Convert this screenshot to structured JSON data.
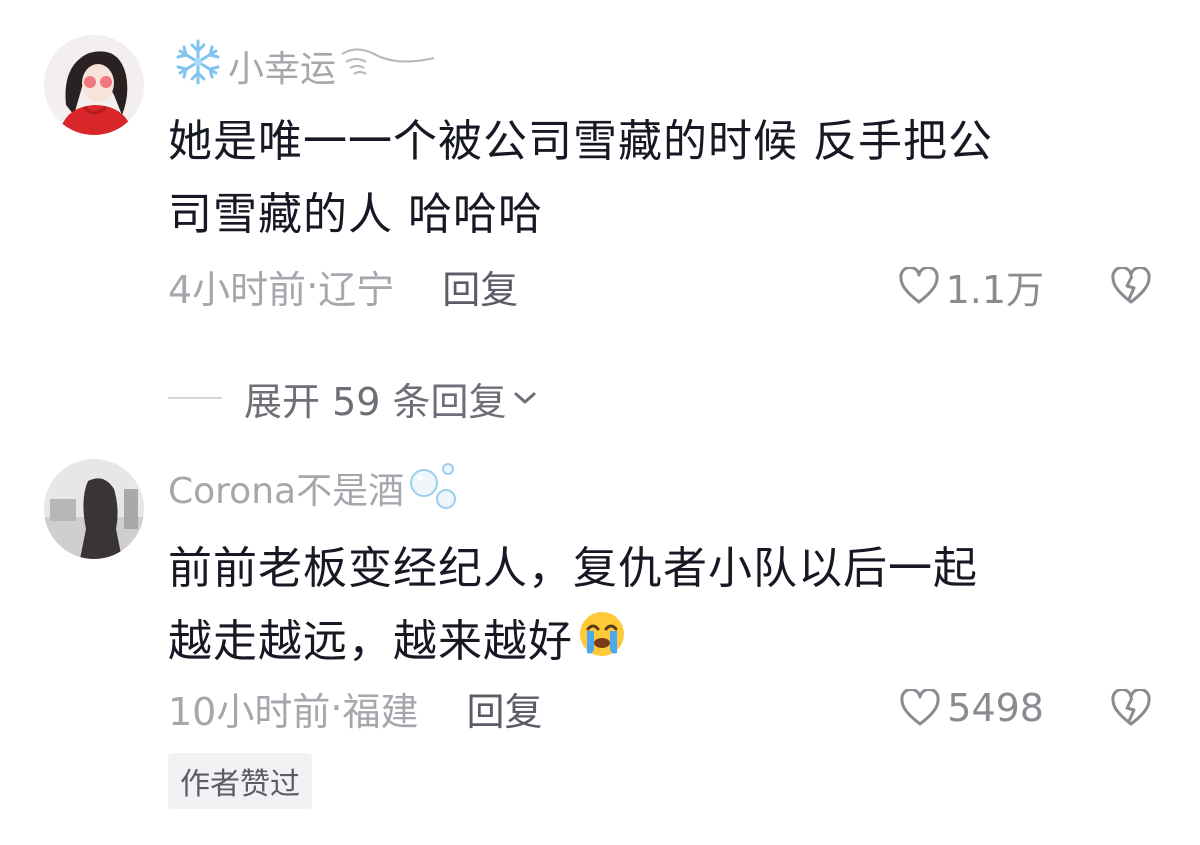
{
  "comments": [
    {
      "username": "小幸运",
      "content_lines": [
        "她是唯一一个被公司雪藏的时候 反手把公",
        "司雪藏的人 哈哈哈"
      ],
      "time": "4小时前",
      "location": "辽宁",
      "reply_label": "回复",
      "likes": "1.1万",
      "name_decorations": [
        "snowflake-icon",
        "wind-swirl-icon"
      ]
    },
    {
      "username": "Corona不是酒",
      "content_lines": [
        "前前老板变经纪人，复仇者小队以后一起",
        "越走越远，越来越好"
      ],
      "content_emoji": "crying-face-emoji",
      "time": "10小时前",
      "location": "福建",
      "reply_label": "回复",
      "likes": "5498",
      "author_badge": "作者赞过",
      "name_decorations": [
        "bubbles-icon"
      ]
    }
  ],
  "expand_replies": "展开 59 条回复",
  "meta_separator": "·",
  "colors": {
    "primary_text": "#161823",
    "secondary_text": "#a6a6ac",
    "reply_text": "#5a5c66",
    "badge_bg": "#f2f2f4"
  }
}
